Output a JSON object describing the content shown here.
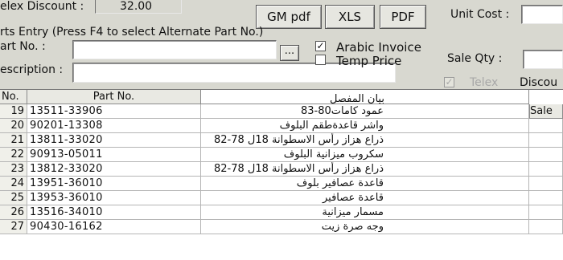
{
  "top": {
    "telex_discount_label": "elex Discount :",
    "telex_discount_value": "32.00",
    "unit_cost_label": "Unit Cost :",
    "buttons": {
      "gm_pdf": "GM pdf",
      "xls": "XLS",
      "pdf": "PDF"
    }
  },
  "entry": {
    "group_title": "rts Entry (Press F4 to select Alternate Part No.)",
    "part_no_label": "art No. :",
    "part_no_value": "",
    "browse_label": "...",
    "description_label": "escription :",
    "description_value": "",
    "arabic_invoice_label": "Arabic Invoice",
    "arabic_invoice_checked": true,
    "temp_price_label": "Temp Price",
    "temp_price_checked": false,
    "sale_qty_label": "Sale Qty :",
    "sale_qty_value": "",
    "telex_label": "Telex",
    "discount_label": "Discou"
  },
  "grid": {
    "columns": {
      "no": "No.",
      "part_no": "Part No.",
      "description": "بيان المفصل",
      "sale": "Sale"
    },
    "rows": [
      {
        "no": "19",
        "part_no": "13511-33906",
        "description": "عمود كامات80-83"
      },
      {
        "no": "20",
        "part_no": "90201-13308",
        "description": "واشر قاعدةطقم البلوف"
      },
      {
        "no": "21",
        "part_no": "13811-33020",
        "description": "ذراع هزاز رأس الاسطوانة 18ل 78-82"
      },
      {
        "no": "22",
        "part_no": "90913-05011",
        "description": "سكروب ميزانية البلوف"
      },
      {
        "no": "23",
        "part_no": "13812-33020",
        "description": "ذراع هزاز رأس الاسطوانة 18ل 78-82"
      },
      {
        "no": "24",
        "part_no": "13951-36010",
        "description": "قاعدة عصافير بلوف"
      },
      {
        "no": "25",
        "part_no": "13953-36010",
        "description": "قاعدة عصافير"
      },
      {
        "no": "26",
        "part_no": "13516-34010",
        "description": "مسمار ميزانية"
      },
      {
        "no": "27",
        "part_no": "90430-16162",
        "description": "وجه صرة زيت"
      }
    ]
  },
  "colors": {
    "window_bg": "#d8d8d0",
    "field_bg": "#ffffff",
    "header_bg": "#e9e9e3"
  }
}
